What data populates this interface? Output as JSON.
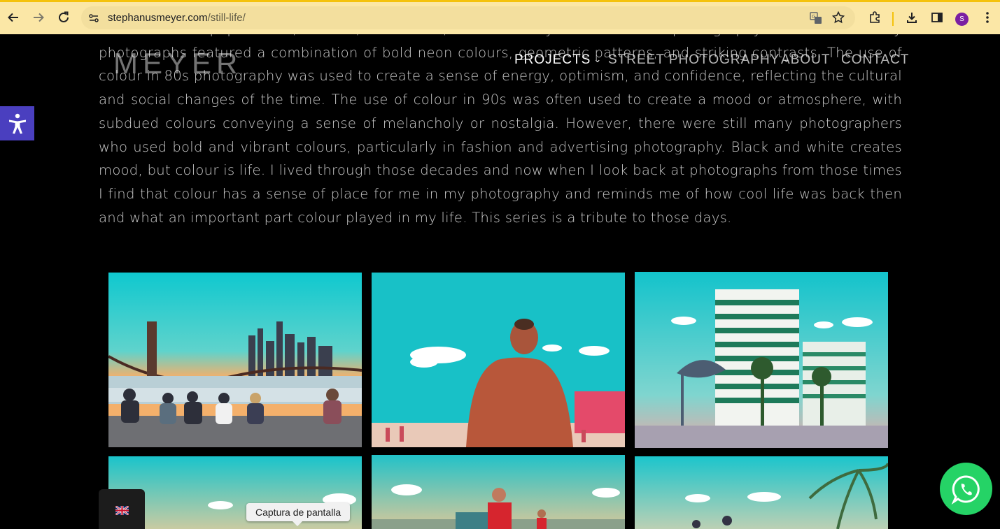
{
  "browser": {
    "url_domain": "stephanusmeyer.com",
    "url_path": "/still-life/",
    "profile_initial": "S",
    "icons": [
      "back-arrow-icon",
      "forward-arrow-icon",
      "reload-icon",
      "site-info-icon",
      "translate-icon",
      "bookmark-star-icon",
      "extensions-icon",
      "download-icon",
      "side-panel-icon",
      "menu-dots-icon"
    ]
  },
  "site": {
    "logo": "MEYER",
    "nav": [
      {
        "label": "PROJECTS",
        "has_dropdown": true
      },
      {
        "label": "STREET PHOTOGRAPHY",
        "has_dropdown": true
      },
      {
        "label": "ABOUT",
        "has_dropdown": false
      },
      {
        "label": "CONTACT",
        "has_dropdown": false
      }
    ]
  },
  "intro_text": "was a time of pop culture, fashion, and music, which heavily influenced the photography of the time. Many photographs featured a combination of bold neon colours, geometric patterns, and striking contrasts. The use of colour in 80s photography was used to create a sense of energy, optimism, and confidence, reflecting the cultural and social changes of the time. The use of colour in 90s was often used to create a mood or atmosphere, with subdued colours conveying a sense of melancholy or nostalgia. However, there were still many photographers who used bold and vibrant colours, particularly in fashion and advertising photography. Black and white creates mood, but colour is life. I lived through those decades and now when I look back at photographs from those times I find that colour has a sense of place for me in my photography and reminds me of how cool life was back then and what an important part colour played in my life. This series is a tribute to those days.",
  "gallery": [
    {
      "subject": "Brooklyn Bridge with people sitting on waterfront"
    },
    {
      "subject": "Shirtless man's back on a beach"
    },
    {
      "subject": "Striped apartment tower with fish sculpture"
    },
    {
      "subject": "Sky with clouds over beach"
    },
    {
      "subject": "Man in red jacket beside a car"
    },
    {
      "subject": "Palm tree and people under sky"
    }
  ],
  "widgets": {
    "accessibility": "accessibility-icon",
    "language_flag": "uk-flag-icon",
    "tooltip": "Captura de pantalla",
    "whatsapp": "whatsapp-icon"
  },
  "colors": {
    "chrome_bg": "#fbe7a6",
    "chrome_accent": "#f4c20d",
    "accessibility_bg": "#4a3fbf",
    "whatsapp_green": "#25d366",
    "sky_teal": "#18c5cc"
  }
}
